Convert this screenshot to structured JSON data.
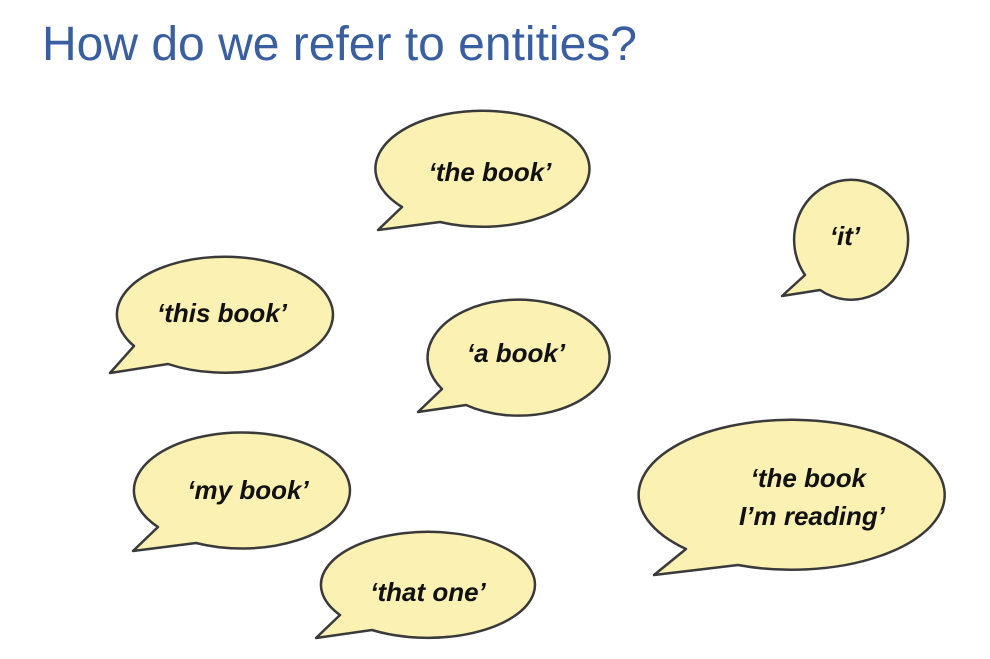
{
  "title": "How do we refer to entities?",
  "bubbles": [
    {
      "lines": [
        "‘the book’"
      ]
    },
    {
      "lines": [
        "‘it’"
      ]
    },
    {
      "lines": [
        "‘this book’"
      ]
    },
    {
      "lines": [
        "‘a book’"
      ]
    },
    {
      "lines": [
        "‘my book’"
      ]
    },
    {
      "lines": [
        "‘the book",
        "I’m reading’"
      ]
    },
    {
      "lines": [
        "‘that one’"
      ]
    }
  ],
  "colors": {
    "title": "#3a5fa0",
    "bubble_fill": "#fbf1b3",
    "bubble_stroke": "#3a3a3a"
  }
}
